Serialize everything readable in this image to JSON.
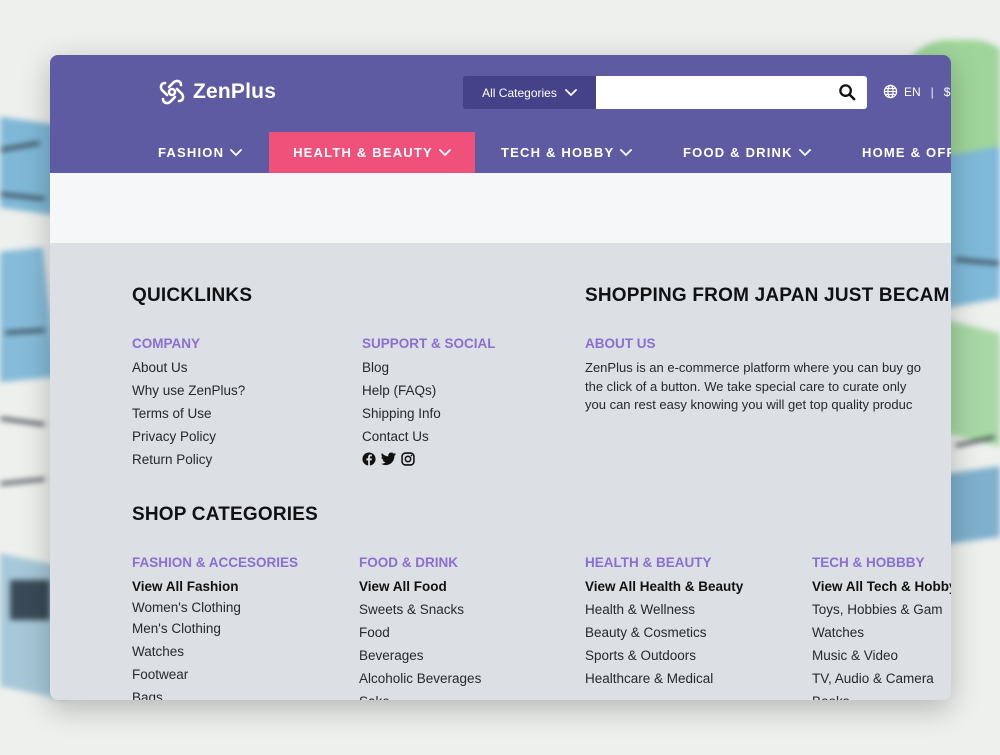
{
  "header": {
    "logo_text": "ZenPlus",
    "category_select": "All Categories",
    "search_placeholder": "",
    "lang": "EN",
    "lang_sep": "|",
    "currency": "$"
  },
  "nav": {
    "items": [
      {
        "label": "FASHION"
      },
      {
        "label": "HEALTH & BEAUTY"
      },
      {
        "label": "TECH & HOBBY"
      },
      {
        "label": "FOOD & DRINK"
      },
      {
        "label": "HOME & OFF"
      }
    ],
    "active_color": "#f0517a"
  },
  "colors": {
    "brand": "#5f5ba3",
    "accent": "#8a6fd0"
  },
  "quicklinks": {
    "title": "QUICKLINKS",
    "company": {
      "title": "COMPANY",
      "links": [
        "About Us",
        "Why use ZenPlus?",
        "Terms of Use",
        "Privacy Policy",
        "Return Policy"
      ]
    },
    "support": {
      "title": "SUPPORT & SOCIAL",
      "links": [
        "Blog",
        "Help (FAQs)",
        "Shipping Info",
        "Contact Us"
      ],
      "social_icons": [
        "facebook-icon",
        "twitter-icon",
        "instagram-icon"
      ]
    }
  },
  "promo": {
    "title": "SHOPPING FROM JAPAN JUST BECAME",
    "about_title": "ABOUT US",
    "about_lines": [
      "ZenPlus is an e-commerce platform where you can buy go",
      "the click of a button. We take special care to curate only",
      "you can rest easy knowing you will get top quality produc"
    ]
  },
  "shop_categories": {
    "title": "SHOP CATEGORIES",
    "columns": [
      {
        "title": "FASHION & ACCESORIES",
        "view_all": "View All Fashion",
        "links": [
          "Women's Clothing",
          "Men's Clothing",
          "Watches",
          "Footwear",
          "Bags"
        ]
      },
      {
        "title": "FOOD & DRINK",
        "view_all": "View All Food",
        "links": [
          "Sweets & Snacks",
          "Food",
          "Beverages",
          "Alcoholic Beverages",
          "Sake"
        ]
      },
      {
        "title": "HEALTH & BEAUTY",
        "view_all": "View All Health & Beauty",
        "links": [
          "Health & Wellness",
          "Beauty & Cosmetics",
          "Sports & Outdoors",
          "Healthcare & Medical"
        ]
      },
      {
        "title": "TECH & HOBBBY",
        "view_all": "View All Tech & Hobby",
        "links": [
          "Toys, Hobbies & Gam",
          "Watches",
          "Music & Video",
          "TV, Audio & Camera",
          "Books"
        ]
      }
    ]
  }
}
